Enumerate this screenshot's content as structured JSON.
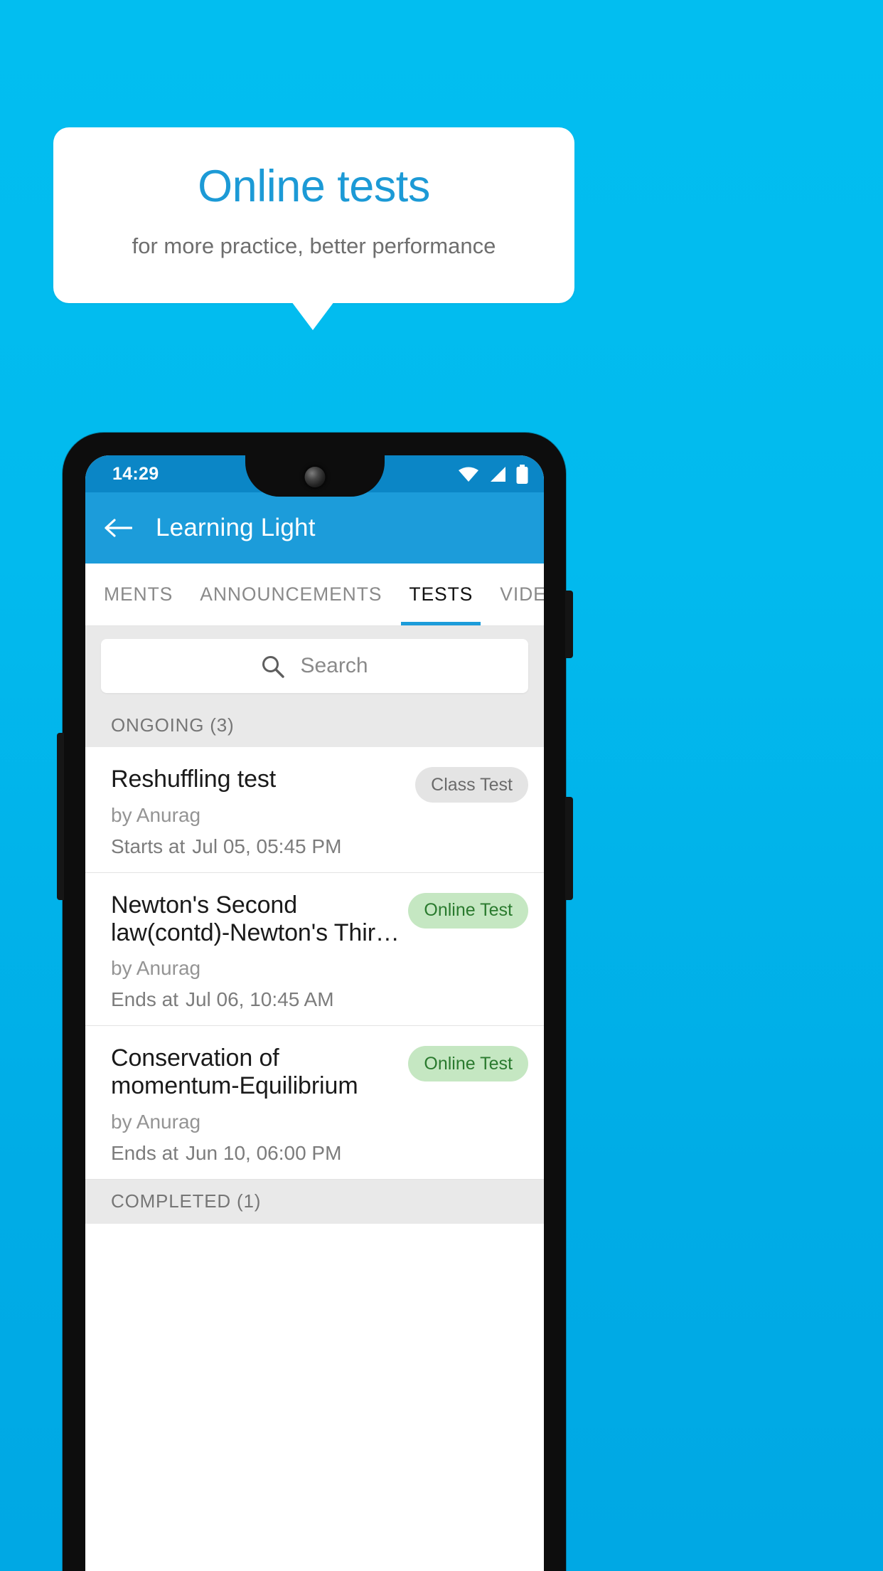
{
  "promo": {
    "title": "Online tests",
    "subtitle": "for more practice, better performance",
    "title_color": "#1C9AD6",
    "background_color": "#02BEF0"
  },
  "phone": {
    "status_bar": {
      "time": "14:29",
      "icons": [
        "wifi-icon",
        "cellular-signal-icon",
        "battery-icon"
      ],
      "background_color": "#0B86C6"
    },
    "app_bar": {
      "back_label": "back-arrow",
      "title": "Learning Light",
      "background_color": "#1C9CDA"
    },
    "tabs": [
      {
        "label": "MENTS",
        "active": false
      },
      {
        "label": "ANNOUNCEMENTS",
        "active": false
      },
      {
        "label": "TESTS",
        "active": true
      },
      {
        "label": "VIDEOS",
        "active": false
      }
    ],
    "search": {
      "placeholder": "Search",
      "icon": "search-icon"
    },
    "sections": [
      {
        "header": "ONGOING (3)",
        "items": [
          {
            "title": "Reshuffling test",
            "author": "by Anurag",
            "time_label": "Starts at",
            "time_value": "Jul 05, 05:45 PM",
            "badge": "Class Test",
            "badge_style": "gray"
          },
          {
            "title": "Newton's Second law(contd)-Newton's Thir…",
            "author": "by Anurag",
            "time_label": "Ends at",
            "time_value": "Jul 06, 10:45 AM",
            "badge": "Online Test",
            "badge_style": "green"
          },
          {
            "title": "Conservation of momentum-Equilibrium",
            "author": "by Anurag",
            "time_label": "Ends at",
            "time_value": "Jun 10, 06:00 PM",
            "badge": "Online Test",
            "badge_style": "green"
          }
        ]
      },
      {
        "header": "COMPLETED (1)",
        "items": []
      }
    ]
  }
}
